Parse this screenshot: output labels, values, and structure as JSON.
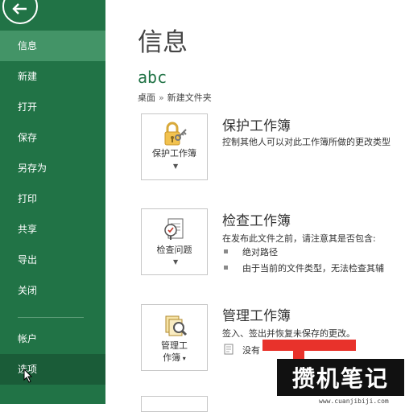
{
  "sidebar": {
    "back_icon": "back-arrow-icon",
    "items": [
      {
        "label": "信息",
        "state": "active"
      },
      {
        "label": "新建"
      },
      {
        "label": "打开"
      },
      {
        "label": "保存"
      },
      {
        "label": "另存为"
      },
      {
        "label": "打印"
      },
      {
        "label": "共享"
      },
      {
        "label": "导出"
      },
      {
        "label": "关闭"
      },
      {
        "label": "帐户"
      },
      {
        "label": "选项",
        "state": "hover"
      }
    ]
  },
  "main": {
    "title": "信息",
    "file_name": "abc",
    "breadcrumb": {
      "parts": [
        "桌面",
        "新建文件夹"
      ],
      "sep": "»"
    },
    "sections": [
      {
        "button_label": "保护工作簿",
        "icon": "lock-key-icon",
        "title": "保护工作簿",
        "description": "控制其他人可以对此工作簿所做的更改类型"
      },
      {
        "button_label": "检查问题",
        "icon": "inspect-checklist-icon",
        "title": "检查工作簿",
        "description": "在发布此文件之前，请注意其是否包含:",
        "bullets": [
          "绝对路径",
          "由于当前的文件类型，无法检查其辅"
        ]
      },
      {
        "button_label_line1": "管理工",
        "button_label_line2": "作簿",
        "icon": "manage-documents-icon",
        "title": "管理工作簿",
        "description": "签入、签出并恢复未保存的更改。",
        "partial_text": "没有"
      }
    ]
  },
  "watermark": {
    "text": "攒机笔记",
    "url": "www.cuanjibiji.com"
  },
  "colors": {
    "sidebar": "#217346",
    "sidebar_active": "#439467",
    "sidebar_hover": "#1a5c38",
    "accent": "#217346",
    "watermark_red": "#e8322b"
  }
}
